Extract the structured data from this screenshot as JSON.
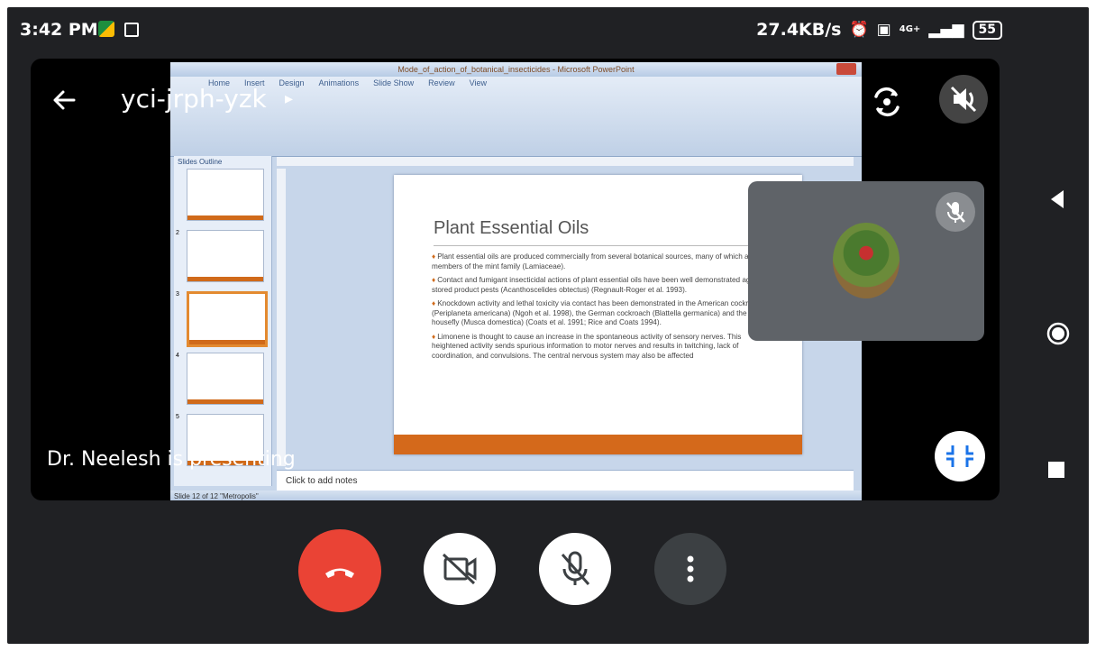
{
  "status_bar": {
    "time": "3:42 PM",
    "net_speed": "27.4KB/s",
    "network_type": "4G+",
    "battery": "55"
  },
  "meeting": {
    "code": "yci-jrph-yzk",
    "presenter_text": "Dr. Neelesh is presenting"
  },
  "shared_screen": {
    "window_title": "Mode_of_action_of_botanical_insecticides - Microsoft PowerPoint",
    "ribbon_tabs": [
      "Home",
      "Insert",
      "Design",
      "Animations",
      "Slide Show",
      "Review",
      "View"
    ],
    "panel_tabs": [
      "Slides",
      "Outline"
    ],
    "slide_numbers": [
      "2",
      "3",
      "4",
      "5"
    ],
    "notes_placeholder": "Click to add notes",
    "status_text": "Slide 12 of 12   \"Metropolis\"",
    "slide": {
      "title": "Plant Essential Oils",
      "bullets": [
        "Plant essential oils are produced commercially from several botanical sources, many of which are members of the mint family (Lamiaceae).",
        "Contact and fumigant insecticidal actions of plant essential oils have been well demonstrated against stored product pests (Acanthoscelides obtectus) (Regnault-Roger et al. 1993).",
        "Knockdown activity and lethal toxicity via contact has been demonstrated in the American cockroach (Periplaneta americana) (Ngoh et al. 1998), the German cockroach (Blattella germanica) and the housefly (Musca domestica) (Coats et al. 1991; Rice and Coats 1994).",
        "Limonene is thought to cause an increase in the spontaneous activity of sensory nerves. This heightened activity sends spurious information to motor nerves and results in twitching, lack of coordination, and convulsions. The central nervous system may also be affected"
      ]
    }
  },
  "colors": {
    "end_call": "#ea4335",
    "slide_accent": "#d4691b",
    "background": "#202124"
  },
  "icons": {
    "back": "arrow-left-icon",
    "rotate": "switch-camera-icon",
    "volume": "volume-muted-icon",
    "mic_muted": "mic-off-icon",
    "compress": "minimize-icon",
    "end_call": "phone-hangup-icon",
    "camera_off": "videocam-off-icon",
    "more": "more-vertical-icon"
  }
}
